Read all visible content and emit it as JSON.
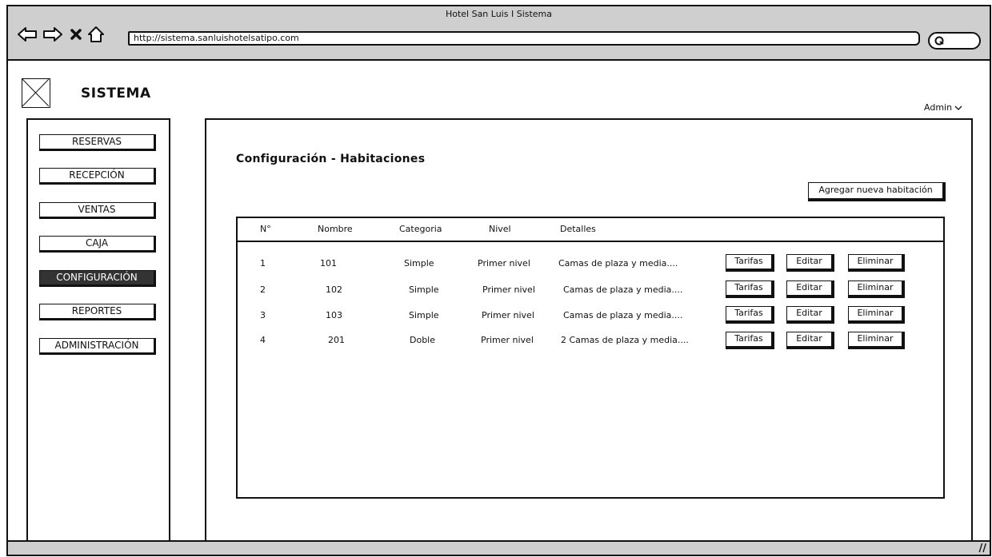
{
  "browser": {
    "window_title": "Hotel San Luis I Sistema",
    "url": "http://sistema.sanluishotelsatipo.com",
    "icons": [
      "back-arrow-icon",
      "forward-arrow-icon",
      "close-icon",
      "home-icon",
      "search-icon"
    ]
  },
  "app": {
    "title": "SISTEMA",
    "user_menu": "Admin",
    "logo_icon": "image-placeholder-icon"
  },
  "sidebar": {
    "items": [
      {
        "label": "RESERVAS",
        "active": false
      },
      {
        "label": "RECEPCIÓN",
        "active": false
      },
      {
        "label": "VENTAS",
        "active": false
      },
      {
        "label": "CAJA",
        "active": false
      },
      {
        "label": "CONFIGURACIÓN",
        "active": true
      },
      {
        "label": "REPORTES",
        "active": false
      },
      {
        "label": "ADMINISTRACIÓN",
        "active": false
      }
    ]
  },
  "main": {
    "page_title": "Configuración - Habitaciones",
    "add_button": "Agregar nueva habitación",
    "table": {
      "headers": [
        "N°",
        "Nombre",
        "Categoria",
        "Nivel",
        "Detalles"
      ],
      "rows": [
        {
          "n": "1",
          "nombre": "101",
          "categoria": "Simple",
          "nivel": "Primer nivel",
          "detalles": "Camas de plaza y media...."
        },
        {
          "n": "2",
          "nombre": "102",
          "categoria": "Simple",
          "nivel": "Primer nivel",
          "detalles": "Camas de plaza y media...."
        },
        {
          "n": "3",
          "nombre": "103",
          "categoria": "Simple",
          "nivel": "Primer nivel",
          "detalles": "Camas de plaza y media...."
        },
        {
          "n": "4",
          "nombre": "201",
          "categoria": "Doble",
          "nivel": "Primer nivel",
          "detalles": "2 Camas de plaza y media...."
        }
      ],
      "row_actions": [
        "Tarifas",
        "Editar",
        "Eliminar"
      ]
    }
  },
  "colors": {
    "chrome_gray": "#cfcfcf",
    "active_nav": "#333333",
    "ink": "#111111"
  }
}
